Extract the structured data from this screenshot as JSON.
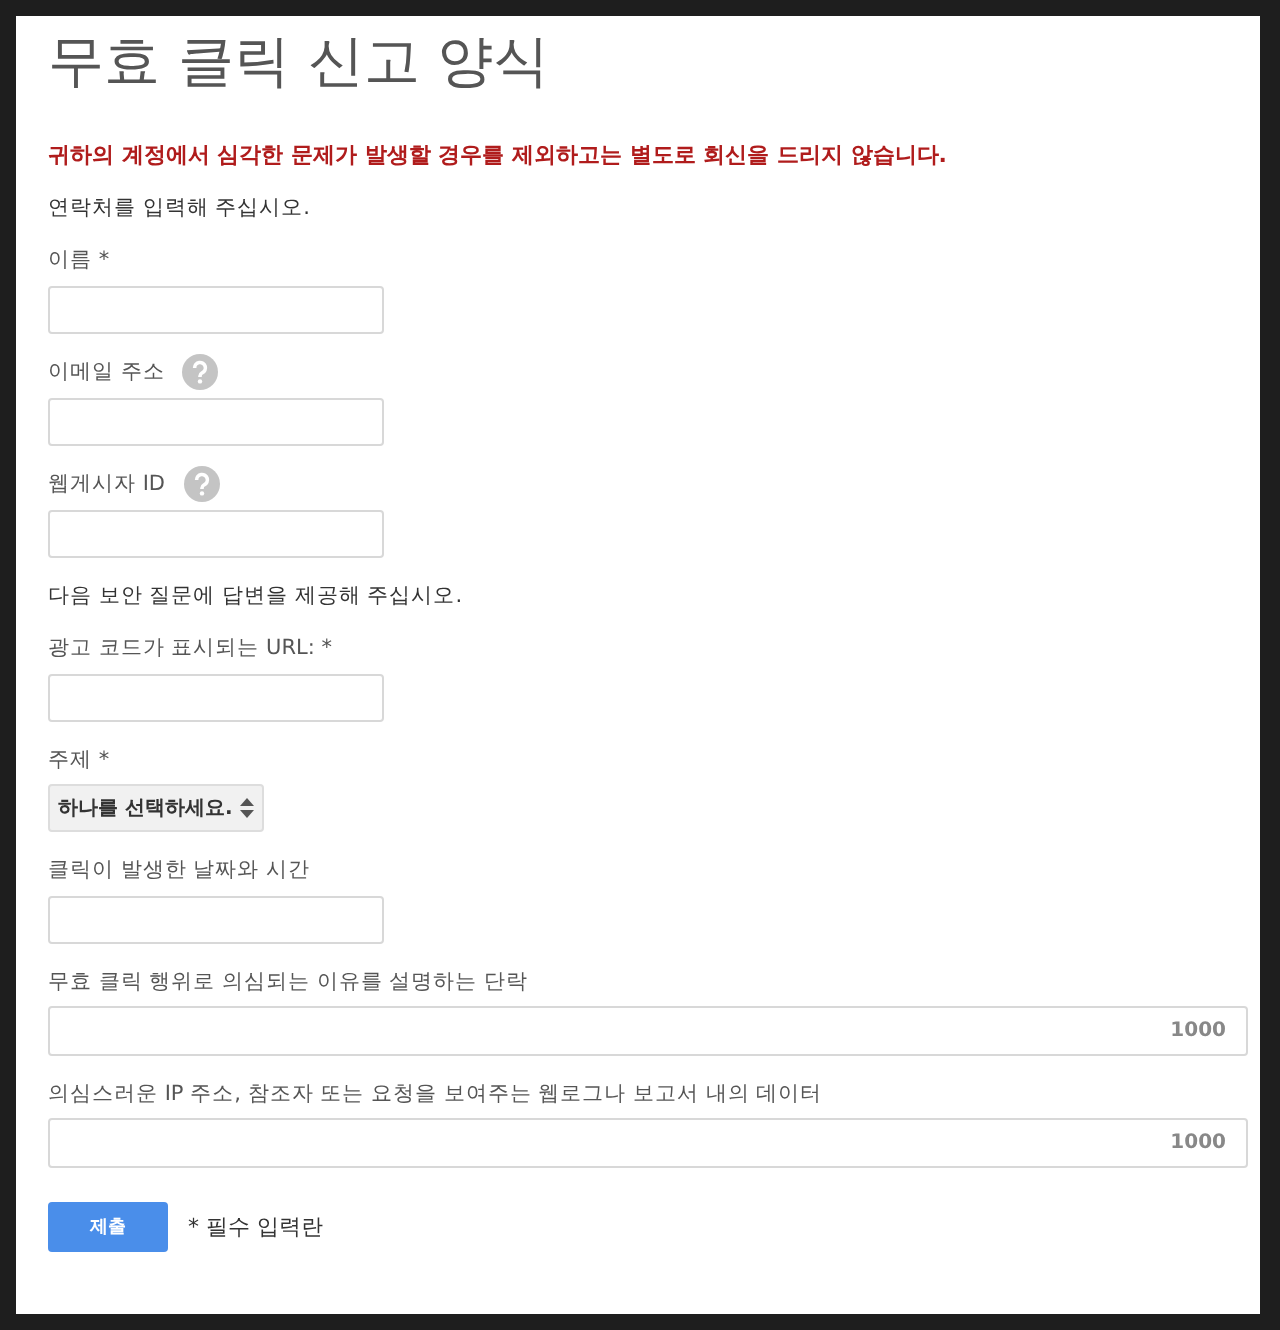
{
  "title": "무효 클릭 신고 양식",
  "warning": "귀하의 계정에서 심각한 문제가 발생할 경우를 제외하고는 별도로 회신을 드리지 않습니다.",
  "sections": [
    {
      "intro": "연락처를 입력해 주십시오.",
      "fields": [
        {
          "kind": "text",
          "label": "이름 *",
          "help": false
        },
        {
          "kind": "text",
          "label": "이메일 주소",
          "help": true
        },
        {
          "kind": "text",
          "label": "웹게시자 ID",
          "help": true
        }
      ]
    },
    {
      "intro": "다음 보안 질문에 답변을 제공해 주십시오.",
      "fields": [
        {
          "kind": "text",
          "label": "광고 코드가 표시되는 URL: *",
          "help": false
        },
        {
          "kind": "select",
          "label": "주제 *",
          "value": "하나를 선택하세요.",
          "help": false
        },
        {
          "kind": "text",
          "label": "클릭이 발생한 날짜와 시간",
          "help": false
        },
        {
          "kind": "textarea",
          "label": "무효 클릭 행위로 의심되는 이유를 설명하는 단락",
          "counter": "1000",
          "help": false
        },
        {
          "kind": "textarea",
          "label": "의심스러운 IP 주소, 참조자 또는 요청을 보여주는 웹로그나 보고서 내의 데이터",
          "counter": "1000",
          "help": false
        }
      ]
    }
  ],
  "submit": "제출",
  "required_note": "* 필수 입력란"
}
